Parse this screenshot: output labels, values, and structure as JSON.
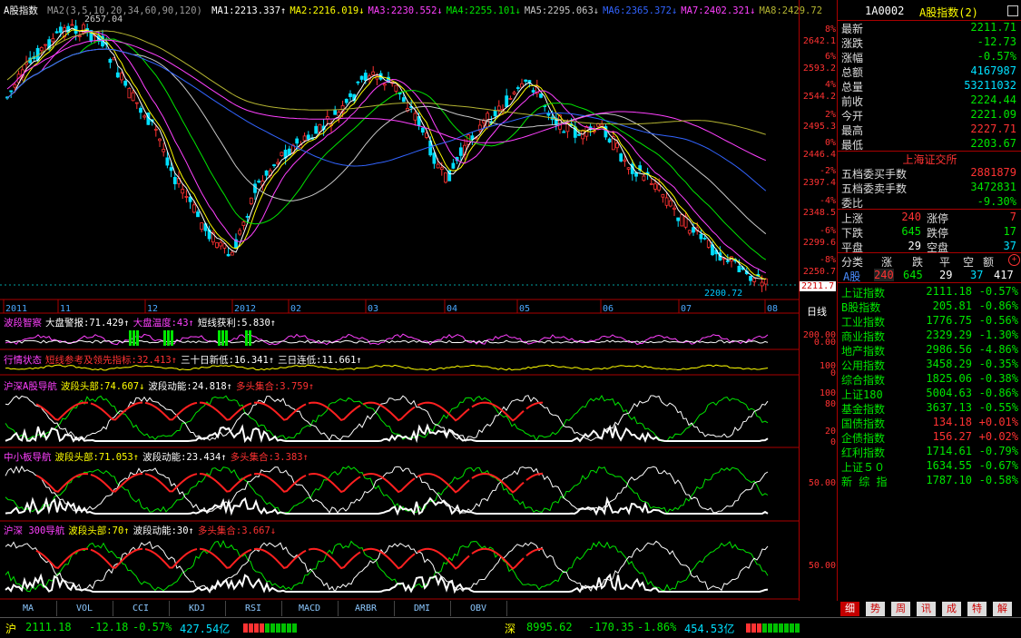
{
  "main": {
    "title": "A股指数",
    "ma_params": "MA2(3,5,10,20,34,60,90,120)",
    "ma": [
      {
        "label": "MA1:2213.337↑",
        "color": "#ffffff"
      },
      {
        "label": "MA2:2216.019↓",
        "color": "#ffff00"
      },
      {
        "label": "MA3:2230.552↓",
        "color": "#ff40ff"
      },
      {
        "label": "MA4:2255.101↓",
        "color": "#00e600"
      },
      {
        "label": "MA5:2295.063↓",
        "color": "#c8c8c8"
      },
      {
        "label": "MA6:2365.372↓",
        "color": "#3264ff"
      },
      {
        "label": "MA7:2402.321↓",
        "color": "#ff40ff"
      },
      {
        "label": "MA8:2429.72",
        "color": "#b4b432"
      }
    ],
    "high_note": "2657.04",
    "low_note": "2200.72",
    "last_price_tag": "2211.7",
    "y_labels": [
      {
        "price": "2642.1",
        "pct": "8%"
      },
      {
        "price": "2593.2",
        "pct": "6%"
      },
      {
        "price": "2544.2",
        "pct": "4%"
      },
      {
        "price": "2495.3",
        "pct": "2%"
      },
      {
        "price": "2446.4",
        "pct": "0%"
      },
      {
        "price": "2397.4",
        "pct": "-2%"
      },
      {
        "price": "2348.5",
        "pct": "-4%"
      },
      {
        "price": "2299.6",
        "pct": "-6%"
      },
      {
        "price": "2250.7",
        "pct": "-8%"
      }
    ],
    "x_labels": [
      "2011",
      "11",
      "12",
      "2012",
      "02",
      "03",
      "04",
      "05",
      "06",
      "07",
      "08"
    ],
    "period": "日线"
  },
  "ind1": {
    "name": "波段智察",
    "items": [
      {
        "t": "大盘警报:71.429↑",
        "c": "#ffffff"
      },
      {
        "t": "大盘温度:43↑",
        "c": "#ff40ff"
      },
      {
        "t": "短线获利:5.830↑",
        "c": "#ffffff"
      }
    ],
    "y": [
      "200.00",
      "0.00"
    ]
  },
  "ind2": {
    "name": "行情状态",
    "items": [
      {
        "t": "短线参考及领先指标:32.413↑",
        "c": "#ff3232"
      },
      {
        "t": "三十日新低:16.341↑",
        "c": "#ffffff"
      },
      {
        "t": "三日连低:11.661↑",
        "c": "#ffffff"
      }
    ],
    "y": [
      "100",
      "0"
    ]
  },
  "ind3": {
    "name": "沪深A股导航",
    "items": [
      {
        "t": "波段头部:74.607↓",
        "c": "#ffff00"
      },
      {
        "t": "波段动能:24.818↑",
        "c": "#ffffff"
      },
      {
        "t": "多头集合:3.759↑",
        "c": "#ff3232"
      }
    ],
    "y": [
      "100",
      "80",
      "20",
      "0"
    ]
  },
  "ind4": {
    "name": "中小板导航",
    "items": [
      {
        "t": "波段头部:71.053↑",
        "c": "#ffff00"
      },
      {
        "t": "波段动能:23.434↑",
        "c": "#ffffff"
      },
      {
        "t": "多头集合:3.383↑",
        "c": "#ff3232"
      }
    ],
    "y": [
      "50.00"
    ]
  },
  "ind5": {
    "name": "沪深 300导航",
    "items": [
      {
        "t": "波段头部:70↑",
        "c": "#ffff00"
      },
      {
        "t": "波段动能:30↑",
        "c": "#ffffff"
      },
      {
        "t": "多头集合:3.667↓",
        "c": "#ff3232"
      }
    ],
    "y": [
      "50.00"
    ]
  },
  "tabs": [
    "MA",
    "VOL",
    "CCI",
    "KDJ",
    "RSI",
    "MACD",
    "ARBR",
    "DMI",
    "OBV"
  ],
  "panel": {
    "code": "1A0002",
    "name": "A股指数(2)",
    "quote": [
      {
        "k": "最新",
        "v": "2211.71",
        "c": "#00e600"
      },
      {
        "k": "涨跌",
        "v": "-12.73",
        "c": "#00e600"
      },
      {
        "k": "涨幅",
        "v": "-0.57%",
        "c": "#00e600"
      },
      {
        "k": "总额",
        "v": "4167987",
        "c": "#00e0ff"
      },
      {
        "k": "总量",
        "v": "53211032",
        "c": "#00e0ff"
      },
      {
        "k": "前收",
        "v": "2224.44",
        "c": "#00e600"
      },
      {
        "k": "今开",
        "v": "2221.09",
        "c": "#00e600"
      },
      {
        "k": "最高",
        "v": "2227.71",
        "c": "#ff3232"
      },
      {
        "k": "最低",
        "v": "2203.67",
        "c": "#00e600"
      }
    ],
    "exchange": "上海证交所",
    "orders": [
      {
        "k": "五档委买手数",
        "v": "2881879",
        "c": "#ff3232"
      },
      {
        "k": "五档委卖手数",
        "v": "3472831",
        "c": "#00e600"
      },
      {
        "k": "委比",
        "v": "-9.30%",
        "c": "#00e600"
      }
    ],
    "breadth": [
      {
        "k1": "上涨",
        "v1": "240",
        "c1": "#ff3232",
        "k2": "涨停",
        "v2": "7",
        "c2": "#ff3232"
      },
      {
        "k1": "下跌",
        "v1": "645",
        "c1": "#00e600",
        "k2": "跌停",
        "v2": "17",
        "c2": "#00e600"
      },
      {
        "k1": "平盘",
        "v1": "29",
        "c1": "#ffffff",
        "k2": "空盘",
        "v2": "37",
        "c2": "#00e0ff"
      }
    ],
    "cat_header": [
      "分类",
      "涨",
      "跌",
      "平",
      "空",
      "额"
    ],
    "cat_row": {
      "name": "A股",
      "up": "240",
      "down": "645",
      "flat": "29",
      "empty": "37",
      "amt": "417"
    },
    "indices": [
      {
        "n": "上证指数",
        "p": "2111.18",
        "c": "-0.57%",
        "col": "#00e600"
      },
      {
        "n": "B股指数",
        "p": "205.81",
        "c": "-0.86%",
        "col": "#00e600"
      },
      {
        "n": "工业指数",
        "p": "1776.75",
        "c": "-0.56%",
        "col": "#00e600"
      },
      {
        "n": "商业指数",
        "p": "2329.29",
        "c": "-1.30%",
        "col": "#00e600"
      },
      {
        "n": "地产指数",
        "p": "2986.56",
        "c": "-4.86%",
        "col": "#00e600"
      },
      {
        "n": "公用指数",
        "p": "3458.29",
        "c": "-0.35%",
        "col": "#00e600"
      },
      {
        "n": "综合指数",
        "p": "1825.06",
        "c": "-0.38%",
        "col": "#00e600"
      },
      {
        "n": "上证180",
        "p": "5004.63",
        "c": "-0.86%",
        "col": "#00e600"
      },
      {
        "n": "基金指数",
        "p": "3637.13",
        "c": "-0.55%",
        "col": "#00e600"
      },
      {
        "n": "国债指数",
        "p": "134.18",
        "c": "+0.01%",
        "col": "#ff3232"
      },
      {
        "n": "企债指数",
        "p": "156.27",
        "c": "+0.02%",
        "col": "#ff3232"
      },
      {
        "n": "红利指数",
        "p": "1714.61",
        "c": "-0.79%",
        "col": "#00e600"
      },
      {
        "n": "上证５０",
        "p": "1634.55",
        "c": "-0.67%",
        "col": "#00e600"
      },
      {
        "n": "新 综 指",
        "p": "1787.10",
        "c": "-0.58%",
        "col": "#00e600"
      }
    ],
    "side_tabs": [
      "细",
      "势",
      "周",
      "讯",
      "成",
      "特",
      "解"
    ]
  },
  "status": {
    "sh": {
      "name": "沪",
      "price": "2111.18",
      "chg": "-12.18",
      "pct": "-0.57%",
      "amt": "427.54亿"
    },
    "sz": {
      "name": "深",
      "price": "8995.62",
      "chg": "-170.35",
      "pct": "-1.86%",
      "amt": "454.53亿"
    }
  }
}
